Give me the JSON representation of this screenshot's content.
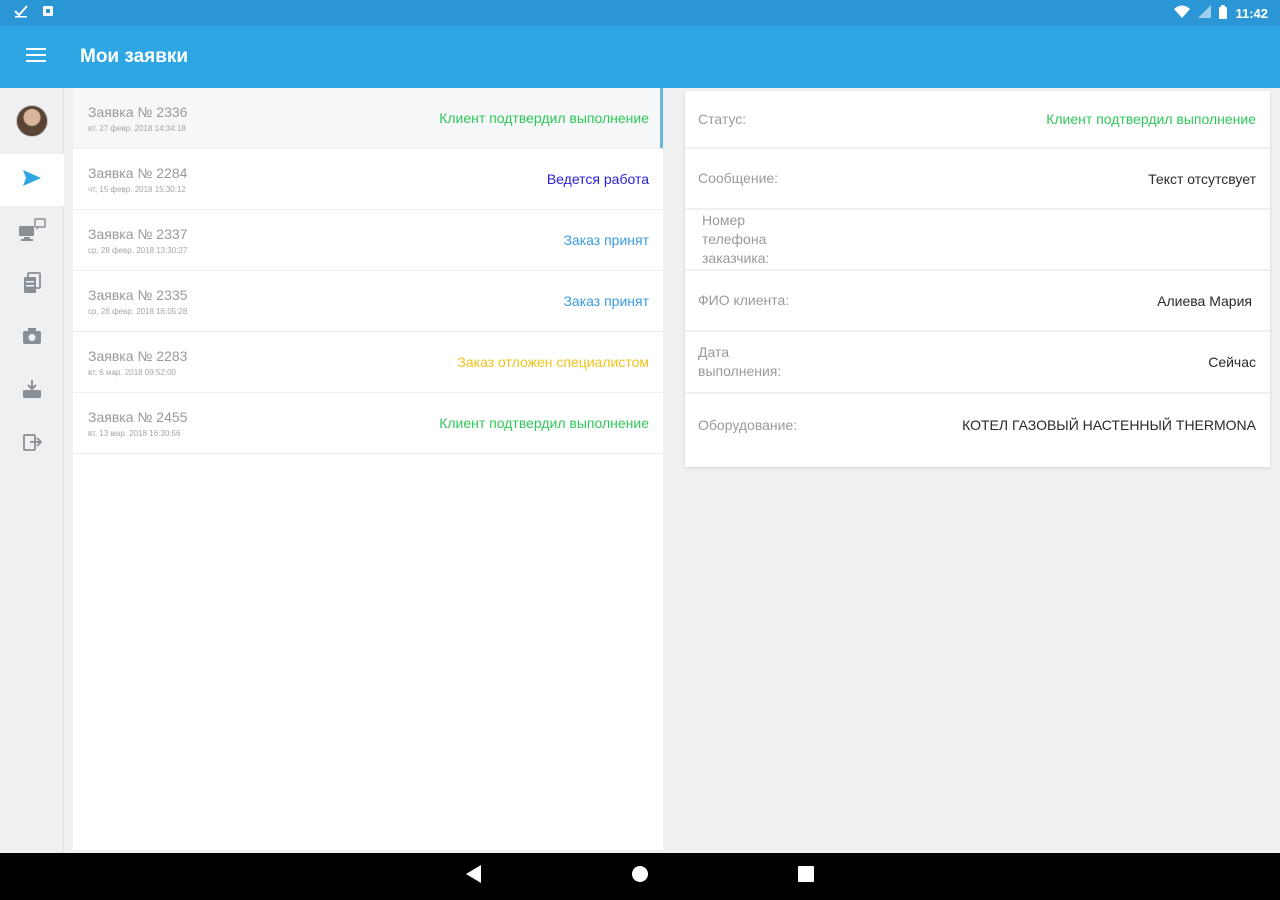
{
  "status_bar": {
    "time": "11:42"
  },
  "app_bar": {
    "title": "Мои заявки"
  },
  "colors": {
    "status_confirmed": "#2fc75a",
    "status_in_progress": "#2a22d8",
    "status_accepted": "#3a9be0",
    "status_postponed": "#f2c21b"
  },
  "rail": {
    "items": [
      {
        "icon": "avatar"
      },
      {
        "icon": "send-icon"
      },
      {
        "icon": "desktop-chat-icon"
      },
      {
        "icon": "documents-icon"
      },
      {
        "icon": "camera-icon"
      },
      {
        "icon": "download-tray-icon"
      },
      {
        "icon": "logout-icon"
      }
    ]
  },
  "requests": [
    {
      "title": "Заявка № 2336",
      "date": "вт, 27 февр. 2018 14:34:18",
      "status": "Клиент подтвердил выполнение",
      "status_color": "#2fc75a"
    },
    {
      "title": "Заявка № 2284",
      "date": "чт, 15 февр. 2018 15:30:12",
      "status": "Ведется работа",
      "status_color": "#2a22d8"
    },
    {
      "title": "Заявка № 2337",
      "date": "ср, 28 февр. 2018 13:30:27",
      "status": "Заказ принят",
      "status_color": "#3a9be0"
    },
    {
      "title": "Заявка № 2335",
      "date": "ср, 28 февр. 2018 16:05:28",
      "status": "Заказ принят",
      "status_color": "#3a9be0"
    },
    {
      "title": "Заявка № 2283",
      "date": "вт, 6 мар. 2018 09:52:00",
      "status": "Заказ отложен специалистом",
      "status_color": "#f2c21b"
    },
    {
      "title": "Заявка № 2455",
      "date": "вт, 13 мар. 2018 16:30:56",
      "status": "Клиент подтвердил выполнение",
      "status_color": "#2fc75a"
    }
  ],
  "details": {
    "status_label": "Статус:",
    "status_value": "Клиент подтвердил выполнение",
    "message_label": "Сообщение:",
    "message_value": "Текст отсутсвует",
    "phone_label": "Номер телефона заказчика:",
    "phone_value": "",
    "client_label": "ФИО клиента:",
    "client_value": "Алиева Мария",
    "date_label": "Дата выполнения:",
    "date_value": "Сейчас",
    "equipment_label": "Оборудование:",
    "equipment_value": "КОТЕЛ ГАЗОВЫЙ НАСТЕННЫЙ THERMONA"
  }
}
